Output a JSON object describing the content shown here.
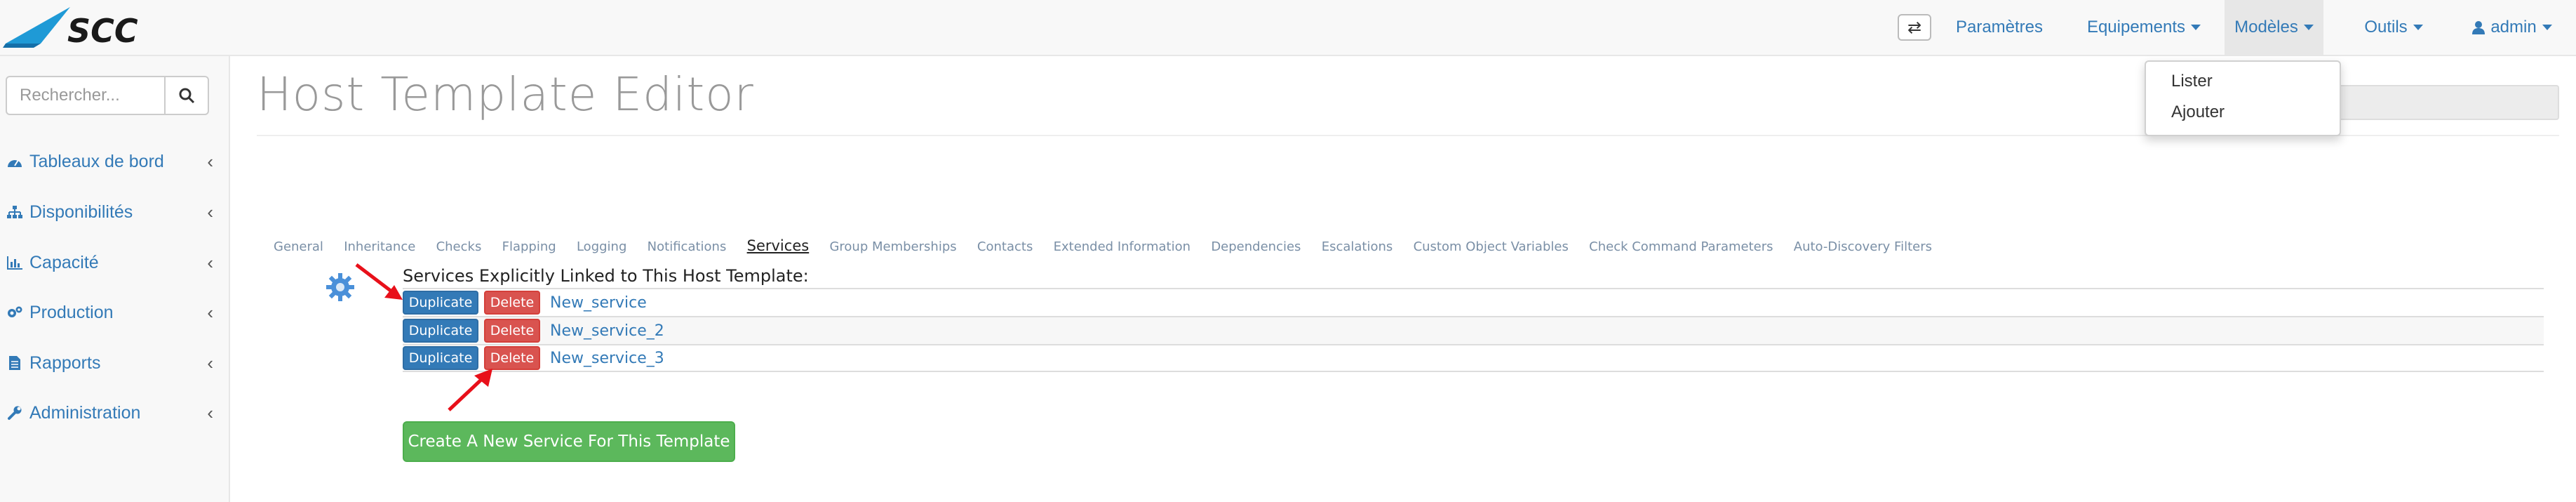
{
  "brand": {
    "logo_text": "SCC",
    "accent": "#337ab7"
  },
  "navbar": {
    "toggle_icon": "exchange-icon",
    "items": [
      {
        "label": "Paramètres",
        "dropdown": false
      },
      {
        "label": "Equipements",
        "dropdown": true
      },
      {
        "label": "Modèles",
        "dropdown": true,
        "active": true
      },
      {
        "label": "Outils",
        "dropdown": true
      },
      {
        "label": "admin",
        "dropdown": true,
        "icon": "user-icon"
      }
    ]
  },
  "modeles_menu": {
    "items": [
      "Lister",
      "Ajouter"
    ]
  },
  "sidebar": {
    "search": {
      "placeholder": "Rechercher...",
      "value": ""
    },
    "items": [
      {
        "label": "Tableaux de bord",
        "icon": "dashboard-icon"
      },
      {
        "label": "Disponibilités",
        "icon": "sitemap-icon"
      },
      {
        "label": "Capacité",
        "icon": "bar-chart-icon"
      },
      {
        "label": "Production",
        "icon": "gears-icon"
      },
      {
        "label": "Rapports",
        "icon": "file-text-icon"
      },
      {
        "label": "Administration",
        "icon": "wrench-icon"
      }
    ]
  },
  "main": {
    "title": "Host Template Editor",
    "tabs": [
      "General",
      "Inheritance",
      "Checks",
      "Flapping",
      "Logging",
      "Notifications",
      "Services",
      "Group Memberships",
      "Contacts",
      "Extended Information",
      "Dependencies",
      "Escalations",
      "Custom Object Variables",
      "Check Command Parameters",
      "Auto-Discovery Filters"
    ],
    "active_tab": "Services",
    "section_title": "Services Explicitly Linked to This Host Template:",
    "duplicate_label": "Duplicate",
    "delete_label": "Delete",
    "services": [
      "New_service",
      "New_service_2",
      "New_service_3"
    ],
    "create_label": "Create A New Service For This Template"
  },
  "colors": {
    "primary": "#337ab7",
    "danger": "#d9534f",
    "success": "#5cb85c",
    "annotation_arrow": "#e8101a"
  }
}
